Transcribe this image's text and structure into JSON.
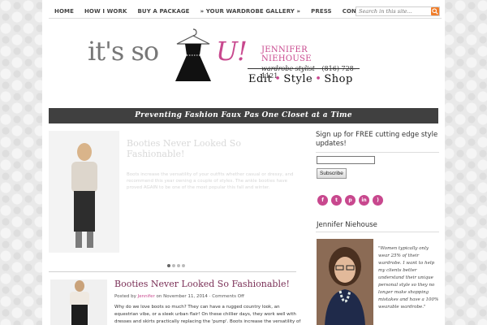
{
  "nav": {
    "items": [
      "HOME",
      "HOW I WORK",
      "BUY A PACKAGE",
      "» YOUR WARDROBE GALLERY »",
      "PRESS",
      "CONTACT"
    ],
    "search_placeholder": "Search in this site...",
    "search_icon": "search-icon"
  },
  "header": {
    "logo_part1": "it's so",
    "logo_part2": "U!",
    "name": "JENNIFER NIEHOUSE",
    "role": "wardrobe stylist",
    "phone": "(816) 728-1121",
    "tagline_1": "Edit",
    "tagline_2": "Style",
    "tagline_3": "Shop",
    "tagline_sep": "•"
  },
  "banner": {
    "text": "Preventing Fashion Faux Pas One Closet at a Time"
  },
  "featured": {
    "title": "Booties Never Looked So Fashionable!",
    "excerpt": "Boots increase the versatility of your outfits whether casual or dressy, and recommend this year owning a couple of styles. The ankle booties have proved AGAIN to be one of the most popular this fall and winter.",
    "slide_count": 4,
    "active_slide": 1
  },
  "post": {
    "title": "Booties Never Looked So Fashionable!",
    "meta_prefix": "Posted by",
    "author": "Jennifer",
    "meta_date": "on November 11, 2014 ·",
    "comments": "Comments Off",
    "text": "Why do we love boots so much? They can have a rugged country look, an equestrian vibe, or a sleek urban flair! On these chillier days, they work well with dresses and skirts practically replacing the 'pump'. Boots increase the versatility of"
  },
  "sidebar": {
    "signup_heading": "Sign up for FREE cutting edge style updates!",
    "subscribe_label": "Subscribe",
    "social": [
      {
        "icon": "facebook-icon",
        "glyph": "f"
      },
      {
        "icon": "twitter-icon",
        "glyph": "t"
      },
      {
        "icon": "pinterest-icon",
        "glyph": "p"
      },
      {
        "icon": "linkedin-icon",
        "glyph": "in"
      },
      {
        "icon": "rss-icon",
        "glyph": ")"
      }
    ],
    "bio_heading": "Jennifer Niehouse",
    "bio_quote": "\"Women typically only wear 25% of their wardrobe. I want to help my clients better understand their unique personal style so they no longer make shopping mistakes and have a 100% wearable wardrobe.\""
  },
  "colors": {
    "accent_pink": "#c8488e",
    "banner_bg": "#404040",
    "search_button": "#f07d2a"
  }
}
